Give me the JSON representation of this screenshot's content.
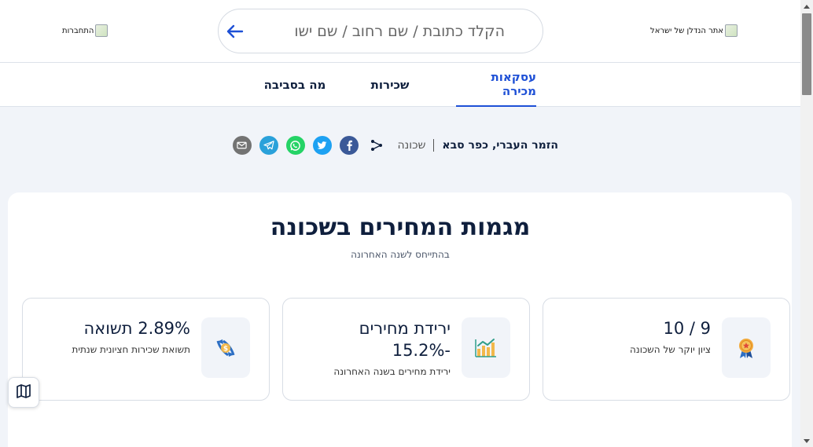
{
  "header": {
    "brand_alt": "אתר הנדלן של ישראל",
    "login_label": "התחברות",
    "search": {
      "placeholder": "הקלד כתובת / שם רחוב / שם ישו"
    }
  },
  "tabs": [
    {
      "label": "עסקאות מכירה",
      "active": true
    },
    {
      "label": "שכירות",
      "active": false
    },
    {
      "label": "מה בסביבה",
      "active": false
    }
  ],
  "address": {
    "title": "הזמר העברי, כפר סבא",
    "type": "שכונה",
    "share_icons": [
      "share-icon",
      "facebook-icon",
      "twitter-icon",
      "whatsapp-icon",
      "telegram-icon",
      "email-icon"
    ]
  },
  "trends": {
    "title": "מגמות המחירים בשכונה",
    "subtitle": "בהתייחס לשנה האחרונה",
    "cards": [
      {
        "icon": "award-ribbon-icon",
        "value": "9 / 10",
        "value2": "",
        "label": "ציון יוקר של השכונה"
      },
      {
        "icon": "chart-down-icon",
        "value": "ירידת מחירים",
        "value2": "-15.2%",
        "label": "ירידת מחירים בשנה האחרונה"
      },
      {
        "icon": "money-exchange-icon",
        "value": "2.89% תשואה",
        "value2": "",
        "label": "תשואת שכירות חציונית שנתית"
      }
    ]
  },
  "colors": {
    "accent": "#1e50d6",
    "text_dark": "#0f1f3d",
    "background": "#f1f4f9",
    "facebook": "#3b5998",
    "twitter": "#1da1f2",
    "whatsapp": "#25d366",
    "telegram": "#2aa1da",
    "email": "#737373"
  }
}
